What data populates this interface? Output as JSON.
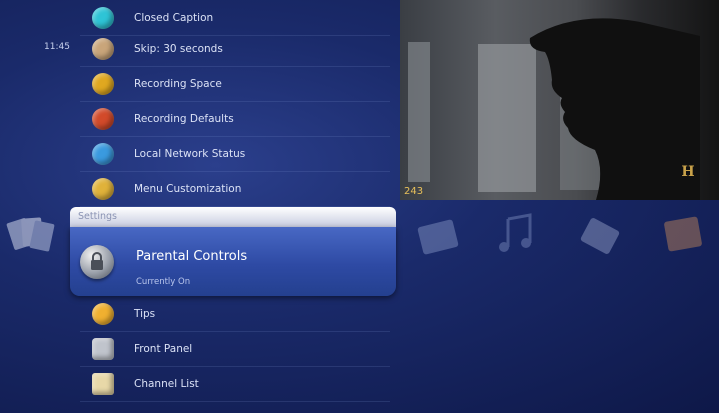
{
  "clock": {
    "time": "11:45"
  },
  "menu": {
    "items_above": [
      {
        "label": "Closed Caption",
        "icon": "closed-caption-icon",
        "color": "#2ec4d6"
      },
      {
        "label": "Skip: 30 seconds",
        "icon": "skip-icon",
        "color": "#c9a57a"
      },
      {
        "label": "Recording Space",
        "icon": "recording-space-icon",
        "color": "#e0a820"
      },
      {
        "label": "Recording Defaults",
        "icon": "recording-defaults-icon",
        "color": "#d24a2a"
      },
      {
        "label": "Local Network Status",
        "icon": "network-icon",
        "color": "#3a9adf"
      },
      {
        "label": "Menu Customization",
        "icon": "menu-customization-icon",
        "color": "#e0b23a"
      }
    ],
    "section_title": "Settings",
    "selected": {
      "label": "Parental Controls",
      "status": "Currently On",
      "icon": "lock-icon"
    },
    "items_below": [
      {
        "label": "Tips",
        "icon": "tips-icon",
        "color": "#f0b030"
      },
      {
        "label": "Front Panel",
        "icon": "front-panel-icon",
        "color": "#c0c4cc"
      },
      {
        "label": "Channel List",
        "icon": "channel-list-icon",
        "color": "#e8d8a8"
      }
    ]
  },
  "preview": {
    "channel": "243",
    "network_logo": "H"
  }
}
